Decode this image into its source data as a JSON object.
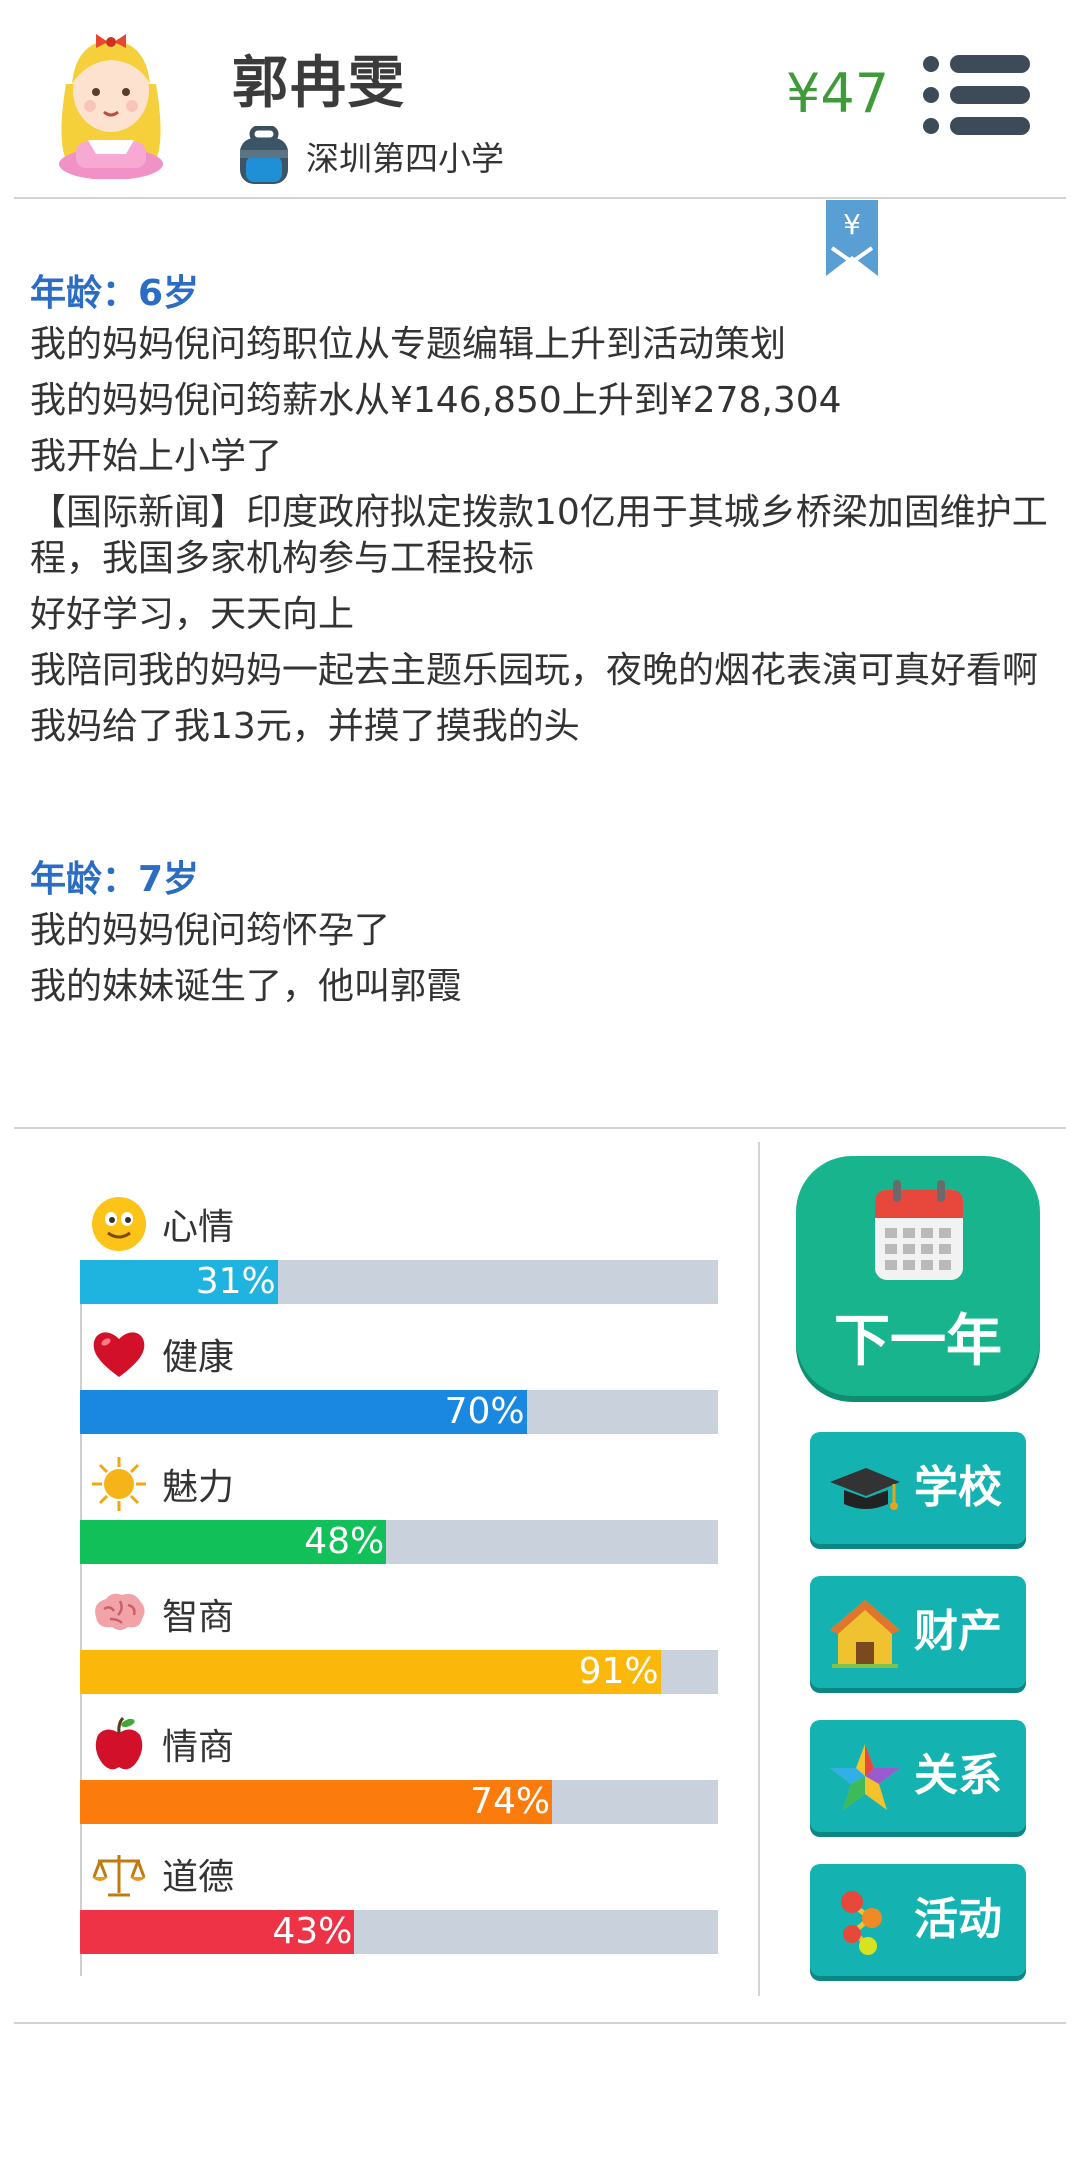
{
  "header": {
    "name": "郭冉雯",
    "school": "深圳第四小学",
    "money": "¥47"
  },
  "bookmark": {
    "symbol": "¥"
  },
  "log": {
    "ages": [
      {
        "title": "年龄：6岁",
        "lines": [
          "我的妈妈倪问筠职位从专题编辑上升到活动策划",
          "我的妈妈倪问筠薪水从¥146,850上升到¥278,304",
          "我开始上小学了",
          "【国际新闻】印度政府拟定拨款10亿用于其城乡桥梁加固维护工程，我国多家机构参与工程投标",
          "好好学习，天天向上",
          "我陪同我的妈妈一起去主题乐园玩，夜晚的烟花表演可真好看啊",
          "我妈给了我13元，并摸了摸我的头"
        ]
      },
      {
        "title": "年龄：7岁",
        "lines": [
          "我的妈妈倪问筠怀孕了",
          "我的妹妹诞生了，他叫郭霞"
        ]
      }
    ]
  },
  "stats": [
    {
      "label": "心情",
      "value": 31,
      "value_text": "31%",
      "color": "#1fb3e0",
      "icon": "smiley-icon"
    },
    {
      "label": "健康",
      "value": 70,
      "value_text": "70%",
      "color": "#1a87e0",
      "icon": "heart-icon"
    },
    {
      "label": "魅力",
      "value": 48,
      "value_text": "48%",
      "color": "#12c05a",
      "icon": "sun-icon"
    },
    {
      "label": "智商",
      "value": 91,
      "value_text": "91%",
      "color": "#fbb70a",
      "icon": "brain-icon"
    },
    {
      "label": "情商",
      "value": 74,
      "value_text": "74%",
      "color": "#fb7c0d",
      "icon": "apple-icon"
    },
    {
      "label": "道德",
      "value": 43,
      "value_text": "43%",
      "color": "#ef3346",
      "icon": "scales-icon"
    }
  ],
  "actions": {
    "next_year": "下一年",
    "school": "学校",
    "property": "财产",
    "relations": "关系",
    "activities": "活动"
  }
}
